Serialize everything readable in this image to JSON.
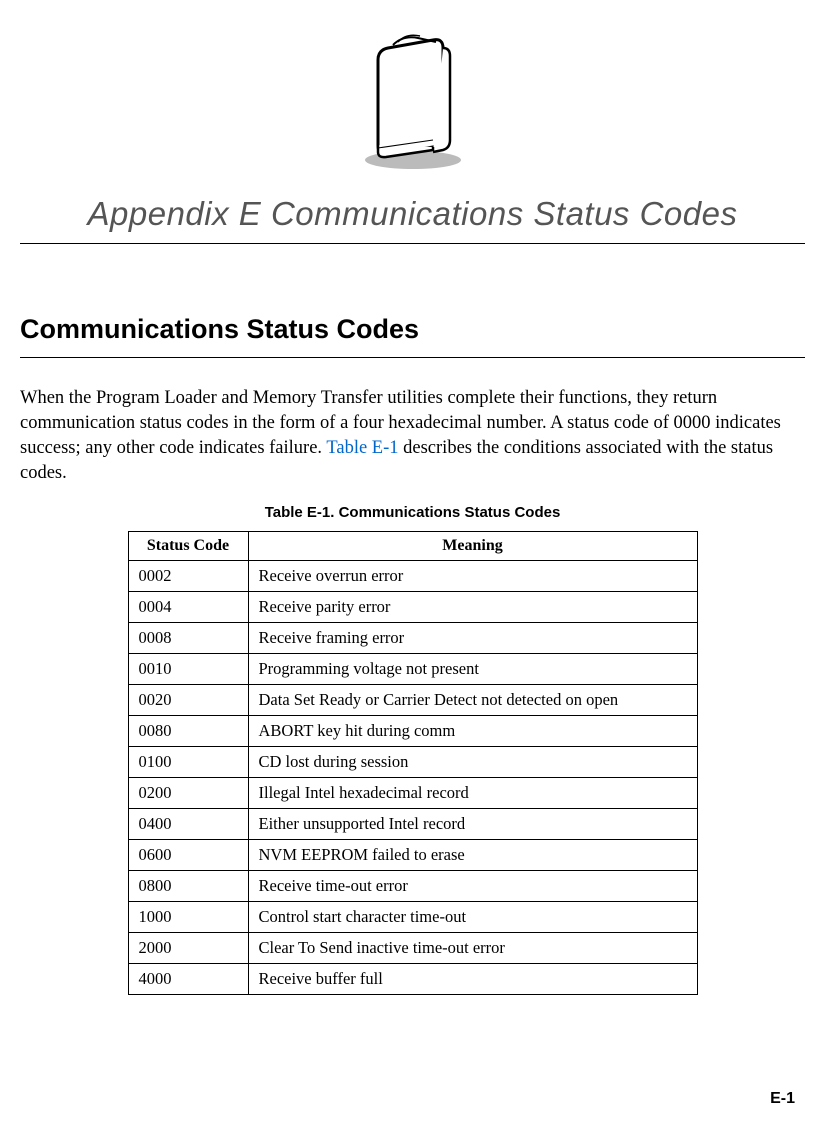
{
  "header": {
    "appendix_title": "Appendix E  Communications Status Codes"
  },
  "section": {
    "heading": "Communications Status Codes",
    "body_before_link": "When the Program Loader and Memory Transfer utilities complete their functions, they return communication status codes in the form of a four hexadecimal number. A status code of 0000 indicates success; any other code indicates failure. ",
    "link_text": "Table E-1",
    "body_after_link": " describes the conditions associated with the status codes."
  },
  "table": {
    "caption": "Table E-1. Communications Status Codes",
    "headers": {
      "code": "Status Code",
      "meaning": "Meaning"
    },
    "rows": [
      {
        "code": "0002",
        "meaning": "Receive overrun error"
      },
      {
        "code": "0004",
        "meaning": "Receive parity error"
      },
      {
        "code": "0008",
        "meaning": "Receive framing error"
      },
      {
        "code": "0010",
        "meaning": "Programming voltage not present"
      },
      {
        "code": "0020",
        "meaning": "Data Set Ready or Carrier Detect not detected on open"
      },
      {
        "code": "0080",
        "meaning": "ABORT key hit during comm"
      },
      {
        "code": "0100",
        "meaning": "CD lost during session"
      },
      {
        "code": "0200",
        "meaning": "Illegal Intel hexadecimal record"
      },
      {
        "code": "0400",
        "meaning": "Either unsupported Intel record"
      },
      {
        "code": "0600",
        "meaning": "NVM EEPROM failed to erase"
      },
      {
        "code": "0800",
        "meaning": "Receive time-out error"
      },
      {
        "code": "1000",
        "meaning": "Control start character time-out"
      },
      {
        "code": "2000",
        "meaning": "Clear To Send inactive time-out error"
      },
      {
        "code": "4000",
        "meaning": "Receive buffer full"
      }
    ]
  },
  "footer": {
    "page_number": "E-1"
  }
}
